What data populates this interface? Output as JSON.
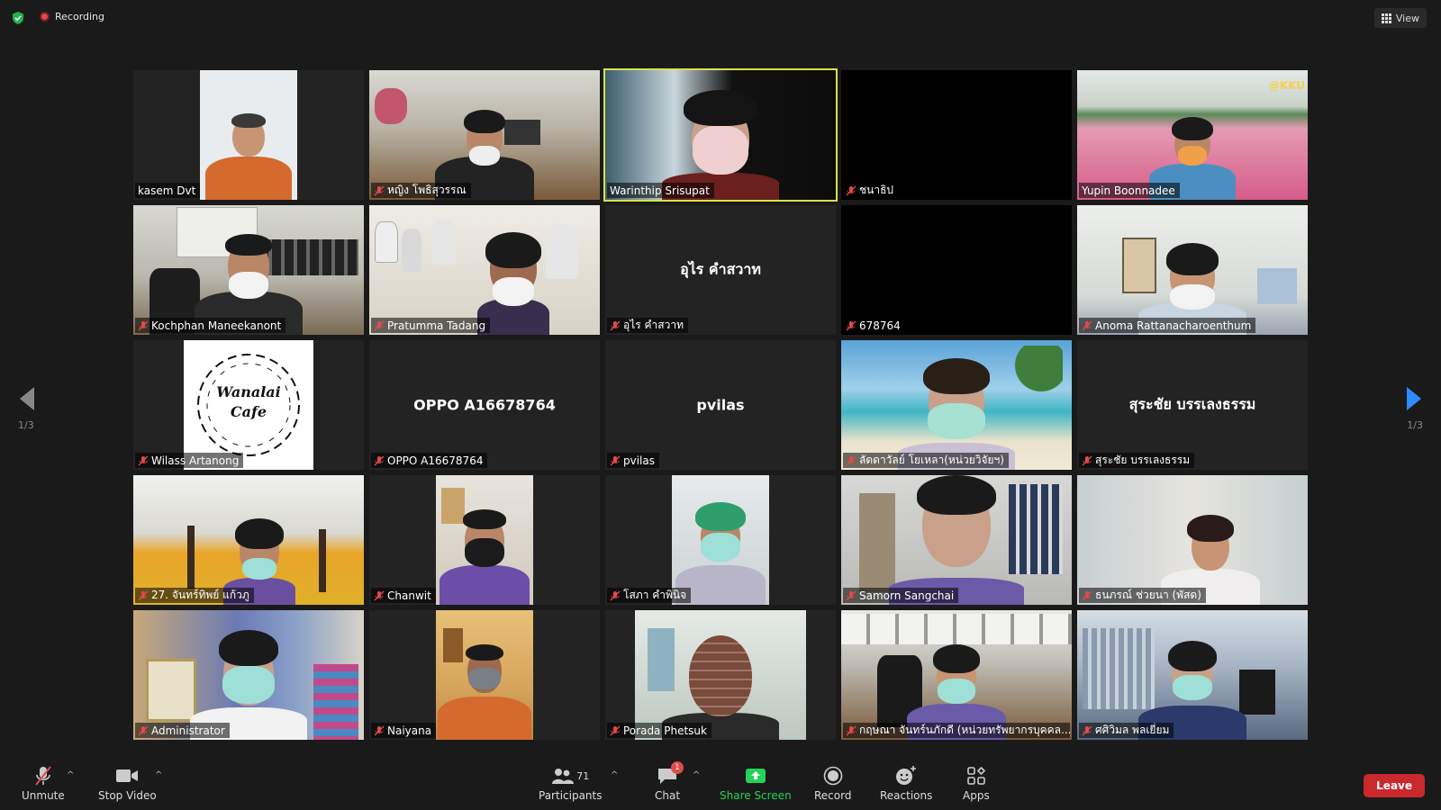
{
  "app": {
    "recording_label": "Recording",
    "view_label": "View",
    "page_left": "1/3",
    "page_right": "1/3",
    "colors": {
      "active_speaker": "#d7e24a",
      "recording": "#e24a4a",
      "share_screen": "#24d356",
      "leave": "#c9282d",
      "background": "#1a1a1a",
      "tile": "#232323"
    }
  },
  "tiles": [
    {
      "name": "kasem Dvt",
      "muted": false,
      "video": true
    },
    {
      "name": "หญิง โพธิสุวรรณ",
      "muted": true,
      "video": true
    },
    {
      "name": "Warinthip Srisupat",
      "muted": false,
      "video": true,
      "active": true
    },
    {
      "name": "ชนาธิป",
      "muted": true,
      "video": false
    },
    {
      "name": "Yupin Boonnadee",
      "muted": false,
      "video": true,
      "overlay": "@KKU"
    },
    {
      "name": "Kochphan Maneekanont",
      "muted": true,
      "video": true
    },
    {
      "name": "Pratumma Tadang",
      "muted": true,
      "video": true
    },
    {
      "name": "อุไร คำสวาท",
      "muted": true,
      "video": false,
      "center_label": "อุไร คำสวาท"
    },
    {
      "name": "678764",
      "muted": true,
      "video": false
    },
    {
      "name": "Anoma Rattanacharoenthum",
      "muted": true,
      "video": true
    },
    {
      "name": "Wilass Artanong",
      "muted": true,
      "video": true,
      "logo_text": [
        "Wanalai",
        "Cafe"
      ]
    },
    {
      "name": "OPPO A16678764",
      "muted": true,
      "video": false,
      "center_label": "OPPO A16678764"
    },
    {
      "name": "pvilas",
      "muted": true,
      "video": false,
      "center_label": "pvilas"
    },
    {
      "name": "ลัดดาวัลย์ โยเหลา(หน่วยวิจัยฯ)",
      "muted": true,
      "video": true
    },
    {
      "name": "สุระชัย บรรเลงธรรม",
      "muted": true,
      "video": false,
      "center_label": "สุระชัย บรรเลงธรรม"
    },
    {
      "name": "27. จันทร์ทิพย์ แก้วภู",
      "muted": true,
      "video": true
    },
    {
      "name": "Chanwit",
      "muted": true,
      "video": true
    },
    {
      "name": "โสภา คำพินิจ",
      "muted": true,
      "video": true
    },
    {
      "name": "Samorn Sangchai",
      "muted": true,
      "video": true
    },
    {
      "name": "ธนภรณ์ ช่วยนา (พัสด)",
      "muted": true,
      "video": true
    },
    {
      "name": "Administrator",
      "muted": true,
      "video": true
    },
    {
      "name": "Naiyana",
      "muted": true,
      "video": true
    },
    {
      "name": "Porada Phetsuk",
      "muted": true,
      "video": true
    },
    {
      "name": "กฤษณา จันทร์นภักดี (หน่วยทรัพยากรบุคคล...",
      "muted": true,
      "video": true
    },
    {
      "name": "ศศิวิมล พลเยี่ยม",
      "muted": true,
      "video": true
    }
  ],
  "toolbar": {
    "unmute": "Unmute",
    "stop_video": "Stop Video",
    "participants": "Participants",
    "participants_count": "71",
    "chat": "Chat",
    "chat_badge": "1",
    "share_screen": "Share Screen",
    "record": "Record",
    "reactions": "Reactions",
    "apps": "Apps",
    "leave": "Leave"
  }
}
